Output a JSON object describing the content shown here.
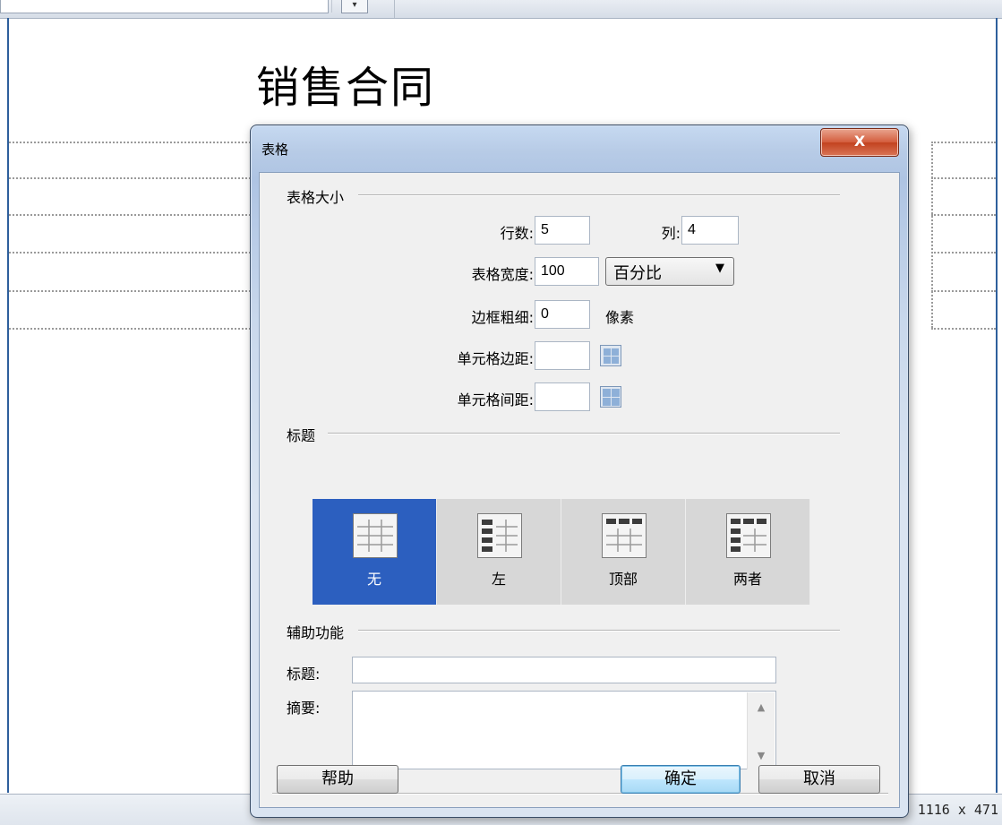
{
  "document": {
    "title": "销售合同"
  },
  "status_bar": {
    "size_text": "1116 x 471"
  },
  "dialog": {
    "title": "表格",
    "close_symbol": "X",
    "table_size": {
      "section_label": "表格大小",
      "rows_label": "行数:",
      "rows_value": "5",
      "cols_label": "列:",
      "cols_value": "4",
      "width_label": "表格宽度:",
      "width_value": "100",
      "width_unit": "百分比",
      "border_label": "边框粗细:",
      "border_value": "0",
      "border_unit": "像素",
      "padding_label": "单元格边距:",
      "padding_value": "",
      "spacing_label": "单元格间距:",
      "spacing_value": ""
    },
    "header": {
      "section_label": "标题",
      "options": [
        {
          "label": "无",
          "selected": true
        },
        {
          "label": "左",
          "selected": false
        },
        {
          "label": "顶部",
          "selected": false
        },
        {
          "label": "两者",
          "selected": false
        }
      ]
    },
    "accessibility": {
      "section_label": "辅助功能",
      "caption_label": "标题:",
      "caption_value": "",
      "summary_label": "摘要:",
      "summary_value": ""
    },
    "buttons": {
      "help": "帮助",
      "ok": "确定",
      "cancel": "取消"
    }
  },
  "colors": {
    "selected_option": "#2c5fbf",
    "title_bar": "#b7cbe6",
    "close_button": "#c2421f"
  }
}
